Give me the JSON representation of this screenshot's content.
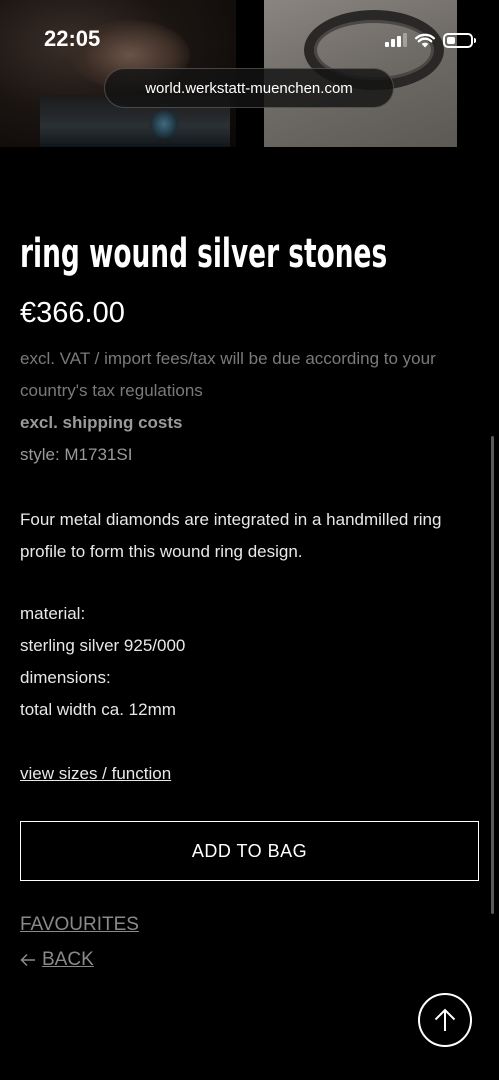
{
  "status_bar": {
    "time": "22:05"
  },
  "browser": {
    "url": "world.werkstatt-muenchen.com"
  },
  "product": {
    "title": "ring wound silver stones",
    "price": "€366.00",
    "vat_note": "excl. VAT / import fees/tax will be due according to your country's tax regulations",
    "shipping_note": "excl. shipping costs",
    "style": "style: M1731SI",
    "description": "Four metal diamonds are integrated in a handmilled ring profile to form this wound ring design.",
    "specs": [
      "material:",
      "sterling silver 925/000",
      "dimensions:",
      "total width ca. 12mm"
    ]
  },
  "actions": {
    "sizes_link": "view sizes / function",
    "add_to_bag": "ADD TO BAG",
    "favourites": "FAVOURITES",
    "back": "BACK"
  },
  "icons": {
    "back_arrow": "arrow-left-icon",
    "scroll_top": "arrow-up-icon"
  }
}
